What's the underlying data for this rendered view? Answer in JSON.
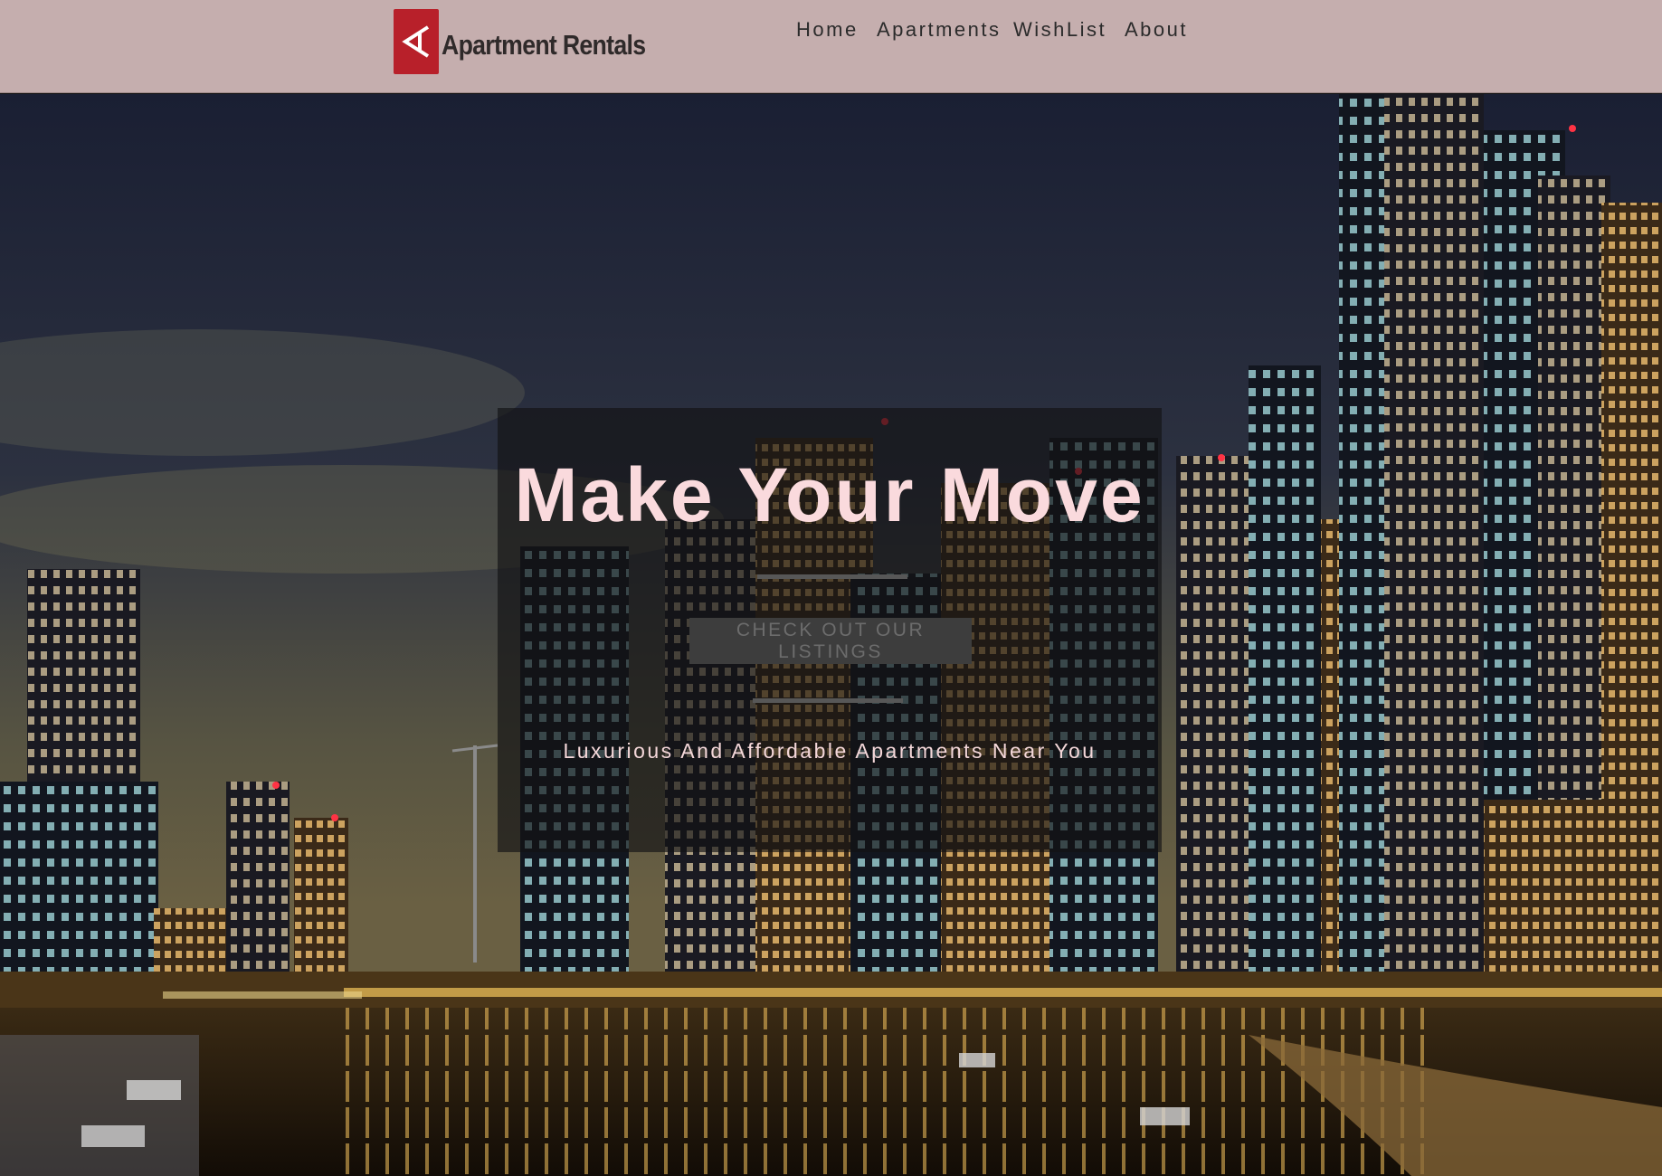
{
  "navbar": {
    "brand": "Apartment Rentals",
    "logo_icon": "triangle-arrow-logo-icon",
    "links": [
      "Home",
      "Apartments",
      "WishList",
      "About"
    ],
    "background_color": "#c5aeae",
    "logo_color": "#b8202a"
  },
  "hero": {
    "background_image": "night-city-marina-skyline",
    "title": "Make Your Move",
    "cta_label": "CHECK OUT OUR LISTINGS",
    "tagline": "Luxurious And Affordable Apartments Near You",
    "title_color": "#fadadd"
  }
}
